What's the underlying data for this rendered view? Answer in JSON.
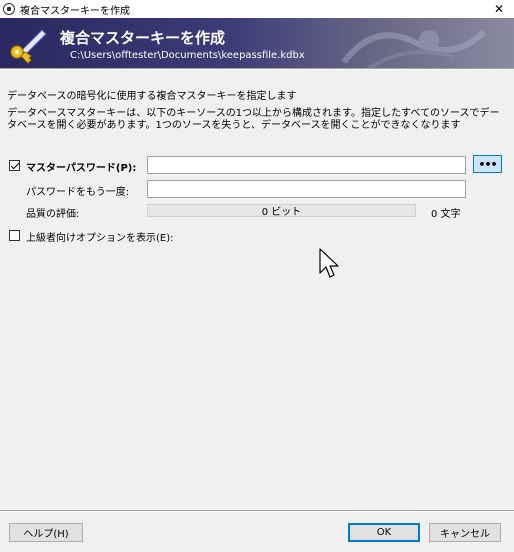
{
  "window": {
    "title": "複合マスターキーを作成",
    "close_glyph": "✕"
  },
  "banner": {
    "title": "複合マスターキーを作成",
    "path": "C:\\Users\\offtester\\Documents\\keepassfile.kdbx",
    "icon": "key-pen-icon"
  },
  "intro": "データベースの暗号化に使用する複合マスターキーを指定します",
  "description": "データベースマスターキーは、以下のキーソースの1つ以上から構成されます。指定したすべてのソースでデータベースを開く必要があります。1つのソースを失うと、データベースを開くことができなくなります",
  "master_password": {
    "checked": true,
    "label": "マスターパスワード(P):",
    "value": "",
    "reveal_label": "•••"
  },
  "repeat_password": {
    "label": "パスワードをもう一度:",
    "value": ""
  },
  "quality": {
    "label": "品質の評価:",
    "bar_text": "0 ビット",
    "fill_fraction": 0.0,
    "char_count": "0 文字"
  },
  "advanced": {
    "checked": false,
    "label": "上級者向けオプションを表示(E):"
  },
  "buttons": {
    "help": "ヘルプ(H)",
    "ok": "OK",
    "cancel": "キャンセル"
  },
  "colors": {
    "banner_start": "#2a2860",
    "accent": "#0078d7",
    "quality_fill": "#06b025"
  }
}
